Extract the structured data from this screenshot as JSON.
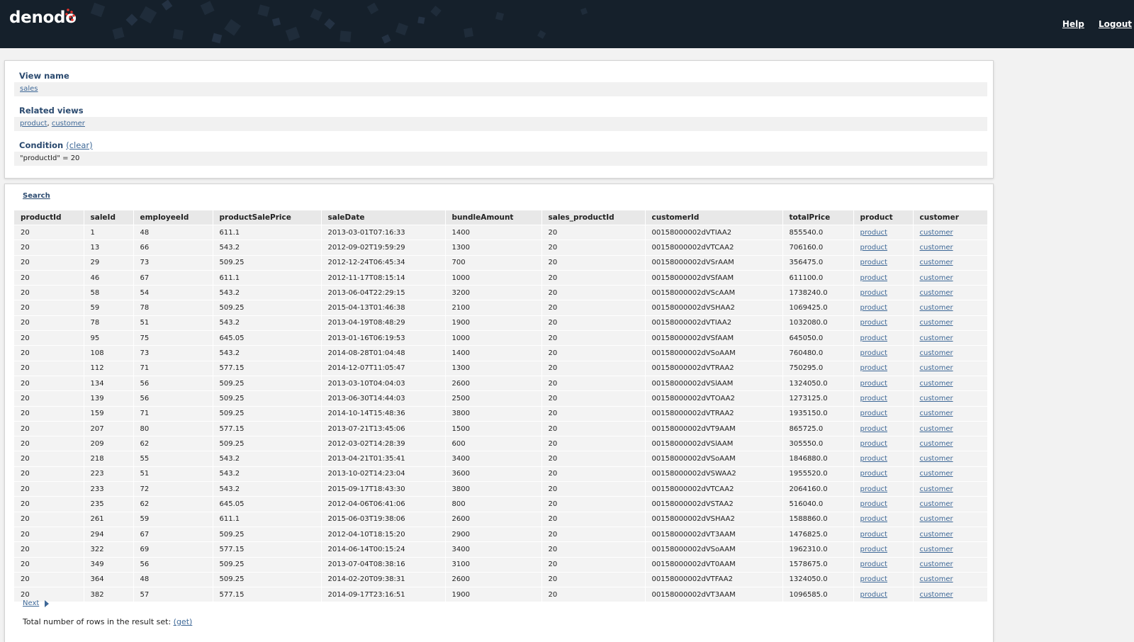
{
  "header": {
    "logo_text": "denodo",
    "help_label": "Help",
    "logout_label": "Logout"
  },
  "info": {
    "view_name_title": "View name",
    "view_name": "sales",
    "related_views_title": "Related views",
    "related_views": [
      "product",
      "customer"
    ],
    "related_sep": ", ",
    "condition_title": "Condition",
    "condition_clear": "(clear)",
    "condition_value": "\"productId\" = 20"
  },
  "results": {
    "search_label": "Search",
    "columns": [
      "productId",
      "saleId",
      "employeeId",
      "productSalePrice",
      "saleDate",
      "bundleAmount",
      "sales_productId",
      "customerId",
      "totalPrice",
      "product",
      "customer"
    ],
    "rows": [
      [
        "20",
        "1",
        "48",
        "611.1",
        "2013-03-01T07:16:33",
        "1400",
        "20",
        "00158000002dVTIAA2",
        "855540.0",
        "product",
        "customer"
      ],
      [
        "20",
        "13",
        "66",
        "543.2",
        "2012-09-02T19:59:29",
        "1300",
        "20",
        "00158000002dVTCAA2",
        "706160.0",
        "product",
        "customer"
      ],
      [
        "20",
        "29",
        "73",
        "509.25",
        "2012-12-24T06:45:34",
        "700",
        "20",
        "00158000002dVSrAAM",
        "356475.0",
        "product",
        "customer"
      ],
      [
        "20",
        "46",
        "67",
        "611.1",
        "2012-11-17T08:15:14",
        "1000",
        "20",
        "00158000002dVSfAAM",
        "611100.0",
        "product",
        "customer"
      ],
      [
        "20",
        "58",
        "54",
        "543.2",
        "2013-06-04T22:29:15",
        "3200",
        "20",
        "00158000002dVScAAM",
        "1738240.0",
        "product",
        "customer"
      ],
      [
        "20",
        "59",
        "78",
        "509.25",
        "2015-04-13T01:46:38",
        "2100",
        "20",
        "00158000002dVSHAA2",
        "1069425.0",
        "product",
        "customer"
      ],
      [
        "20",
        "78",
        "51",
        "543.2",
        "2013-04-19T08:48:29",
        "1900",
        "20",
        "00158000002dVTIAA2",
        "1032080.0",
        "product",
        "customer"
      ],
      [
        "20",
        "95",
        "75",
        "645.05",
        "2013-01-16T06:19:53",
        "1000",
        "20",
        "00158000002dVSfAAM",
        "645050.0",
        "product",
        "customer"
      ],
      [
        "20",
        "108",
        "73",
        "543.2",
        "2014-08-28T01:04:48",
        "1400",
        "20",
        "00158000002dVSoAAM",
        "760480.0",
        "product",
        "customer"
      ],
      [
        "20",
        "112",
        "71",
        "577.15",
        "2014-12-07T11:05:47",
        "1300",
        "20",
        "00158000002dVTRAA2",
        "750295.0",
        "product",
        "customer"
      ],
      [
        "20",
        "134",
        "56",
        "509.25",
        "2013-03-10T04:04:03",
        "2600",
        "20",
        "00158000002dVSlAAM",
        "1324050.0",
        "product",
        "customer"
      ],
      [
        "20",
        "139",
        "56",
        "509.25",
        "2013-06-30T14:44:03",
        "2500",
        "20",
        "00158000002dVTOAA2",
        "1273125.0",
        "product",
        "customer"
      ],
      [
        "20",
        "159",
        "71",
        "509.25",
        "2014-10-14T15:48:36",
        "3800",
        "20",
        "00158000002dVTRAA2",
        "1935150.0",
        "product",
        "customer"
      ],
      [
        "20",
        "207",
        "80",
        "577.15",
        "2013-07-21T13:45:06",
        "1500",
        "20",
        "00158000002dVT9AAM",
        "865725.0",
        "product",
        "customer"
      ],
      [
        "20",
        "209",
        "62",
        "509.25",
        "2012-03-02T14:28:39",
        "600",
        "20",
        "00158000002dVSlAAM",
        "305550.0",
        "product",
        "customer"
      ],
      [
        "20",
        "218",
        "55",
        "543.2",
        "2013-04-21T01:35:41",
        "3400",
        "20",
        "00158000002dVSoAAM",
        "1846880.0",
        "product",
        "customer"
      ],
      [
        "20",
        "223",
        "51",
        "543.2",
        "2013-10-02T14:23:04",
        "3600",
        "20",
        "00158000002dVSWAA2",
        "1955520.0",
        "product",
        "customer"
      ],
      [
        "20",
        "233",
        "72",
        "543.2",
        "2015-09-17T18:43:30",
        "3800",
        "20",
        "00158000002dVTCAA2",
        "2064160.0",
        "product",
        "customer"
      ],
      [
        "20",
        "235",
        "62",
        "645.05",
        "2012-04-06T06:41:06",
        "800",
        "20",
        "00158000002dVSTAA2",
        "516040.0",
        "product",
        "customer"
      ],
      [
        "20",
        "261",
        "59",
        "611.1",
        "2015-06-03T19:38:06",
        "2600",
        "20",
        "00158000002dVSHAA2",
        "1588860.0",
        "product",
        "customer"
      ],
      [
        "20",
        "294",
        "67",
        "509.25",
        "2012-04-10T18:15:20",
        "2900",
        "20",
        "00158000002dVT3AAM",
        "1476825.0",
        "product",
        "customer"
      ],
      [
        "20",
        "322",
        "69",
        "577.15",
        "2014-06-14T00:15:24",
        "3400",
        "20",
        "00158000002dVSoAAM",
        "1962310.0",
        "product",
        "customer"
      ],
      [
        "20",
        "349",
        "56",
        "509.25",
        "2013-07-04T08:38:16",
        "3100",
        "20",
        "00158000002dVT0AAM",
        "1578675.0",
        "product",
        "customer"
      ],
      [
        "20",
        "364",
        "48",
        "509.25",
        "2014-02-20T09:38:31",
        "2600",
        "20",
        "00158000002dVTFAA2",
        "1324050.0",
        "product",
        "customer"
      ],
      [
        "20",
        "382",
        "57",
        "577.15",
        "2014-09-17T23:16:51",
        "1900",
        "20",
        "00158000002dVT3AAM",
        "1096585.0",
        "product",
        "customer"
      ]
    ],
    "next_label": "Next",
    "total_rows_label": "Total number of rows in the result set: ",
    "total_rows_get": "(get)"
  }
}
